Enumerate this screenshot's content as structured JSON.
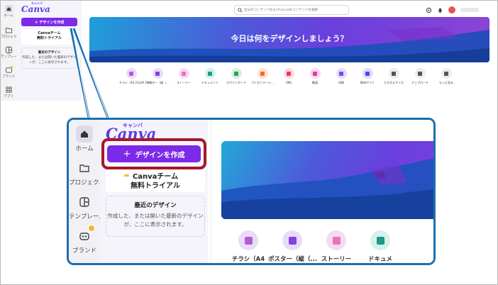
{
  "rail": {
    "items": [
      {
        "label": "ホーム"
      },
      {
        "label": "プロジェク..."
      },
      {
        "label": "テンプレー..."
      },
      {
        "label": "ブランド"
      },
      {
        "label": "アプリ"
      }
    ]
  },
  "panel": {
    "logo": "Canva",
    "logo_kana": "キャンバ",
    "create_label": "デザインを作成",
    "trial_line1": "Canvaチーム",
    "trial_line2": "無料トライアル",
    "recent_title": "最近のデザイン",
    "recent_desc": "作成した、または開いた最新のデザインが、ここに表示されます。"
  },
  "search": {
    "placeholder": "自分のコンテンツおよびCanvaのコンテンツを検索"
  },
  "hero": {
    "title": "今日は何をデザインしましょう？"
  },
  "categories": [
    {
      "label": "チラシ（A4 21x29.7cm）",
      "color": "#e8dcf9",
      "dot": "#b55bd6"
    },
    {
      "label": "ポスター（縦（...",
      "color": "#e8dcf9",
      "dot": "#8a3fe0"
    },
    {
      "label": "ストーリー",
      "color": "#f6dbef",
      "dot": "#e474c4"
    },
    {
      "label": "ドキュメント",
      "color": "#d4f1ec",
      "dot": "#1c9a86"
    },
    {
      "label": "ホワイトボード",
      "color": "#d4f1dc",
      "dot": "#2d9d5b"
    },
    {
      "label": "プレゼンテーシ...",
      "color": "#fde1d4",
      "dot": "#ef6b2a"
    },
    {
      "label": "SNS",
      "color": "#fbd9df",
      "dot": "#e33c5d"
    },
    {
      "label": "動画",
      "color": "#f8d8ef",
      "dot": "#d93aa8"
    },
    {
      "label": "印刷",
      "color": "#e5dcfa",
      "dot": "#7d4ae0"
    },
    {
      "label": "Webサイト",
      "color": "#dcdcfa",
      "dot": "#4b4be0"
    },
    {
      "label": "カスタムサイズ",
      "color": "#ececf1",
      "dot": "#555555"
    },
    {
      "label": "アップロード",
      "color": "#ececf1",
      "dot": "#555555"
    },
    {
      "label": "もっと見る",
      "color": "#ececf1",
      "dot": "#555555"
    }
  ],
  "zoom": {
    "rail": [
      {
        "label": "ホーム"
      },
      {
        "label": "プロジェク..."
      },
      {
        "label": "テンプレー..."
      },
      {
        "label": "ブランド"
      }
    ],
    "categories": [
      {
        "label": "チラシ（A4",
        "color": "#e8dcf9",
        "dot": "#b55bd6"
      },
      {
        "label": "ポスター（縦（...",
        "color": "#e8dcf9",
        "dot": "#8a3fe0"
      },
      {
        "label": "ストーリー",
        "color": "#f6dbef",
        "dot": "#e474c4"
      },
      {
        "label": "ドキュメ",
        "color": "#d4f1ec",
        "dot": "#1c9a86"
      }
    ]
  },
  "colors": {
    "accent": "#7d2ae8",
    "highlight": "#a5182a",
    "callout": "#1a6fb0"
  }
}
